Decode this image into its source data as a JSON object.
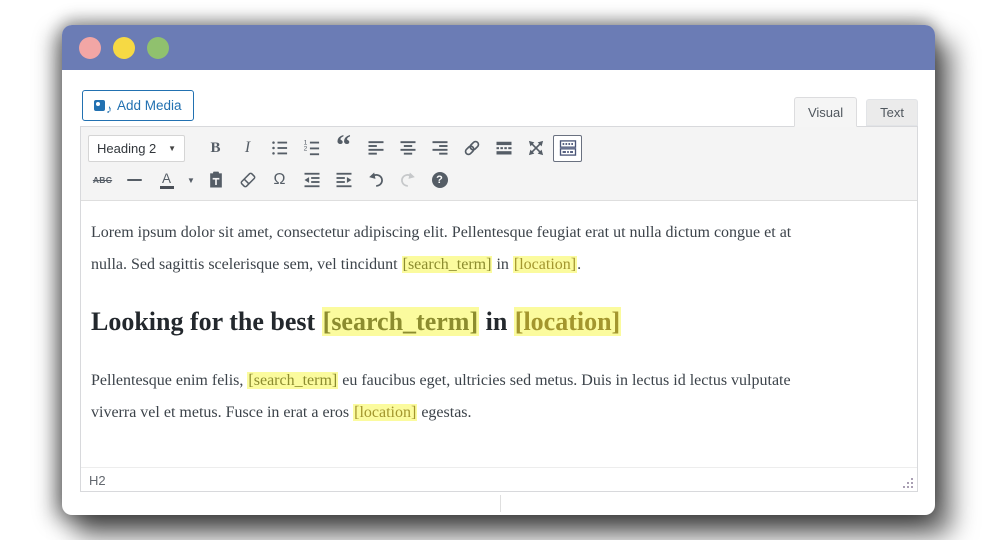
{
  "window": {
    "titlebar_color": "#6b7cb5",
    "traffic_lights": {
      "close": "#f2a6a5",
      "minimize": "#f6d944",
      "zoom": "#90c16e"
    }
  },
  "editor": {
    "add_media_label": "Add Media",
    "add_media_icon": "media-icon",
    "accent_color": "#2271b1",
    "tabs": [
      {
        "label": "Visual",
        "active": true
      },
      {
        "label": "Text",
        "active": false
      }
    ],
    "toolbar": {
      "heading_select_value": "Heading 2",
      "row1_icons": [
        "bold-icon",
        "italic-icon",
        "bulleted-list-icon",
        "numbered-list-icon",
        "blockquote-icon",
        "align-left-icon",
        "align-center-icon",
        "align-right-icon",
        "link-icon",
        "read-more-icon",
        "fullscreen-icon",
        "toolbar-toggle-icon"
      ],
      "row2_icons": [
        "strikethrough-icon",
        "horizontal-rule-icon",
        "text-color-icon",
        "paste-as-text-icon",
        "clear-formatting-icon",
        "special-character-icon",
        "outdent-icon",
        "indent-icon",
        "undo-icon",
        "redo-icon",
        "help-icon"
      ],
      "bold_label": "B",
      "italic_label": "I",
      "blockquote_label": "“",
      "strikethrough_label": "ABC",
      "special_character_label": "Ω",
      "text_color_label": "A",
      "toolbar_toggle_active": true,
      "redo_disabled": true
    },
    "content": {
      "highlight_bg": "#fbfb9e",
      "search_term_color": "#8c8c2f",
      "location_color": "#a3962e",
      "paragraph1_lines": [
        [
          {
            "text": "Lorem ipsum dolor sit amet, consectetur adipiscing elit. Pellentesque feugiat erat ut nulla dictum congue et at"
          }
        ],
        [
          {
            "text": "nulla. Sed sagittis scelerisque sem, vel tincidunt "
          },
          {
            "text": "[search_term]",
            "token": "search"
          },
          {
            "text": " in "
          },
          {
            "text": "[location]",
            "token": "location"
          },
          {
            "text": "."
          }
        ]
      ],
      "heading_segments": [
        {
          "text": "Looking for the best "
        },
        {
          "text": "[search_term]",
          "token": "search"
        },
        {
          "text": " in "
        },
        {
          "text": "[location]",
          "token": "location"
        }
      ],
      "paragraph2_lines": [
        [
          {
            "text": "Pellentesque enim felis, "
          },
          {
            "text": "[search_term]",
            "token": "search"
          },
          {
            "text": " eu faucibus eget, ultricies sed metus. Duis in lectus id lectus vulputate"
          }
        ],
        [
          {
            "text": "viverra vel et metus. Fusce in erat a eros "
          },
          {
            "text": "[location]",
            "token": "location"
          },
          {
            "text": " egestas."
          }
        ]
      ]
    },
    "statusbar": {
      "path": "H2"
    }
  }
}
